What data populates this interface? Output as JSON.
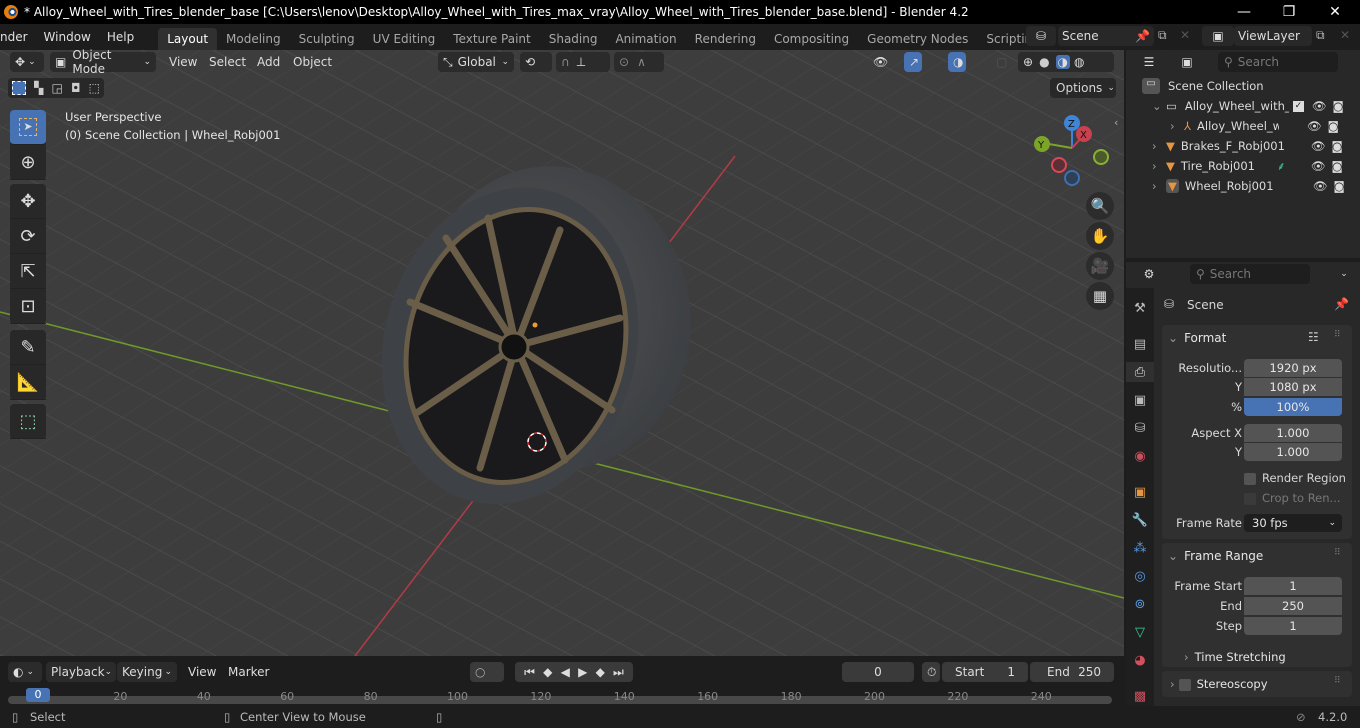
{
  "window": {
    "title": "* Alloy_Wheel_with_Tires_blender_base [C:\\Users\\lenov\\Desktop\\Alloy_Wheel_with_Tires_max_vray\\Alloy_Wheel_with_Tires_blender_base.blend] - Blender 4.2",
    "minimize": "—",
    "maximize": "❐",
    "close": "✕"
  },
  "menubar": {
    "items": [
      "nder",
      "Window",
      "Help"
    ],
    "workspaces": [
      "Layout",
      "Modeling",
      "Sculpting",
      "UV Editing",
      "Texture Paint",
      "Shading",
      "Animation",
      "Rendering",
      "Compositing",
      "Geometry Nodes",
      "Scripting"
    ],
    "active_workspace": "Layout",
    "add_workspace": "+",
    "scene": "Scene",
    "view_layer": "ViewLayer"
  },
  "viewport": {
    "mode": "Object Mode",
    "menus": [
      "View",
      "Select",
      "Add",
      "Object"
    ],
    "transform_orientation": "Global",
    "options_label": "Options",
    "info_line1": "User Perspective",
    "info_line2": "(0) Scene Collection | Wheel_Robj001",
    "gizmo": {
      "x": "X",
      "y": "Y",
      "z": "Z"
    },
    "tools": [
      "select-box",
      "cursor",
      "move",
      "rotate",
      "scale",
      "transform",
      "annotate",
      "measure",
      "add-cube"
    ],
    "active_tool": "select-box"
  },
  "outliner": {
    "search_placeholder": "Search",
    "root": "Scene Collection",
    "rows": [
      {
        "label": "Alloy_Wheel_with_",
        "type": "collection",
        "level": 1,
        "expanded": true,
        "checked": true
      },
      {
        "label": "Alloy_Wheel_wi",
        "type": "empty",
        "level": 2,
        "expanded": false
      },
      {
        "label": "Brakes_F_Robj001",
        "type": "mesh",
        "level": 1,
        "expanded": false
      },
      {
        "label": "Tire_Robj001",
        "type": "mesh",
        "level": 1,
        "expanded": false,
        "has_modifier": true
      },
      {
        "label": "Wheel_Robj001",
        "type": "mesh",
        "level": 1,
        "expanded": false,
        "active": true
      }
    ]
  },
  "properties": {
    "search_placeholder": "Search",
    "context": "Scene",
    "format": {
      "title": "Format",
      "resolution_label": "Resolutio...",
      "resolution_x": "1920 px",
      "y_label": "Y",
      "resolution_y": "1080 px",
      "percent_label": "%",
      "resolution_percent": "100%",
      "aspect_label": "Aspect X",
      "aspect_x": "1.000",
      "aspect_y_label": "Y",
      "aspect_y": "1.000",
      "render_region": "Render Region",
      "crop": "Crop to Ren...",
      "frame_rate_label": "Frame Rate",
      "frame_rate": "30 fps"
    },
    "frame_range": {
      "title": "Frame Range",
      "start_label": "Frame Start",
      "start": "1",
      "end_label": "End",
      "end": "250",
      "step_label": "Step",
      "step": "1",
      "time_stretching": "Time Stretching"
    },
    "stereoscopy": "Stereoscopy"
  },
  "timeline": {
    "menus": [
      "Playback",
      "Keying",
      "View",
      "Marker"
    ],
    "current_frame": "0",
    "start_label": "Start",
    "start": "1",
    "end_label": "End",
    "end": "250",
    "ticks": [
      "0",
      "20",
      "40",
      "60",
      "80",
      "100",
      "120",
      "140",
      "160",
      "180",
      "200",
      "220",
      "240"
    ]
  },
  "statusbar": {
    "select": "Select",
    "center_view": "Center View to Mouse",
    "version": "4.2.0"
  },
  "colors": {
    "accent": "#4772b3",
    "x_axis": "#c8414e",
    "y_axis": "#7ba428",
    "z_axis": "#3d85d8",
    "object_orange": "#e49645"
  }
}
